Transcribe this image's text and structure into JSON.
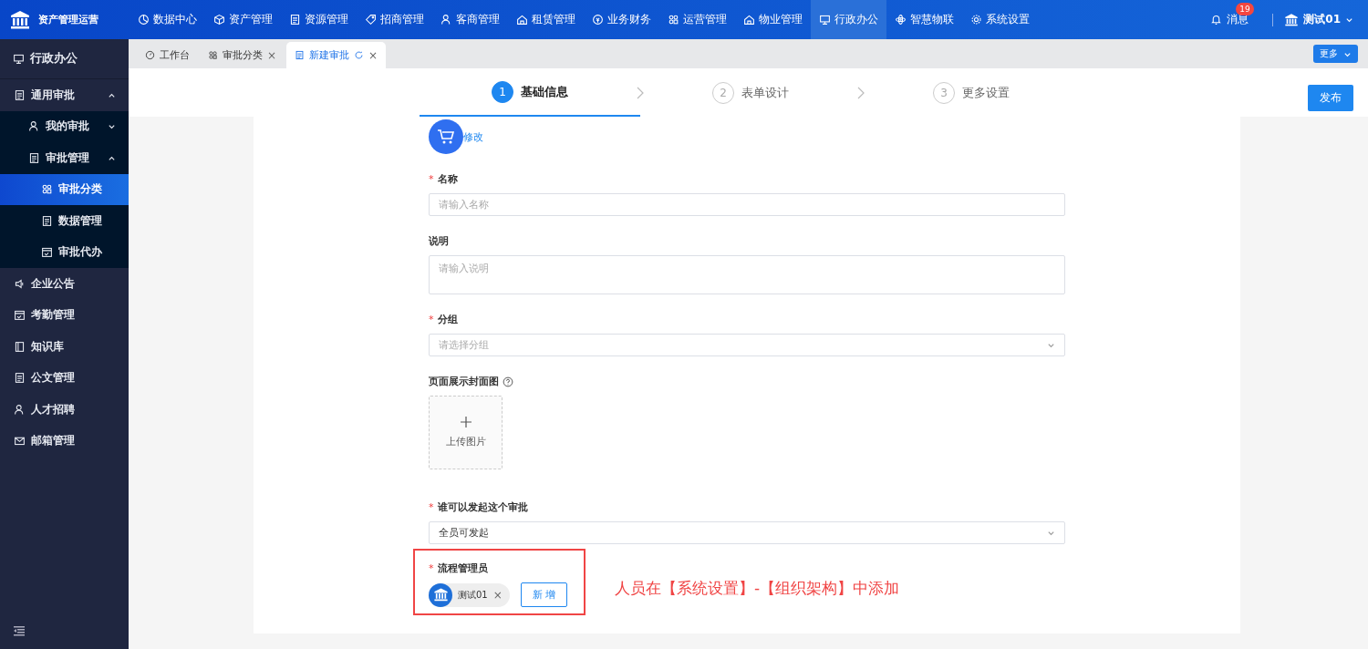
{
  "topbar": {
    "logo_title": "资产管理运营",
    "nav": [
      {
        "label": "数据中心",
        "selected": false
      },
      {
        "label": "资产管理",
        "selected": false
      },
      {
        "label": "资源管理",
        "selected": false
      },
      {
        "label": "招商管理",
        "selected": false
      },
      {
        "label": "客商管理",
        "selected": false
      },
      {
        "label": "租赁管理",
        "selected": false
      },
      {
        "label": "业务财务",
        "selected": false
      },
      {
        "label": "运营管理",
        "selected": false
      },
      {
        "label": "物业管理",
        "selected": false
      },
      {
        "label": "行政办公",
        "selected": true
      },
      {
        "label": "智慧物联",
        "selected": false
      },
      {
        "label": "系统设置",
        "selected": false
      }
    ],
    "messages": {
      "label": "消息",
      "badge": "19"
    },
    "user": {
      "name": "测试01"
    }
  },
  "sidebar": {
    "title": "行政办公",
    "items": [
      {
        "label": "通用审批",
        "selected": false,
        "expanded": true,
        "children": [
          {
            "label": "我的审批",
            "selected": false,
            "expanded": false
          },
          {
            "label": "审批管理",
            "selected": false,
            "expanded": true,
            "children": [
              {
                "label": "审批分类",
                "selected": true
              },
              {
                "label": "数据管理",
                "selected": false
              },
              {
                "label": "审批代办",
                "selected": false
              }
            ]
          }
        ]
      },
      {
        "label": "企业公告",
        "selected": false
      },
      {
        "label": "考勤管理",
        "selected": false
      },
      {
        "label": "知识库",
        "selected": false
      },
      {
        "label": "公文管理",
        "selected": false
      },
      {
        "label": "人才招聘",
        "selected": false
      },
      {
        "label": "邮箱管理",
        "selected": false
      }
    ]
  },
  "tabs": [
    {
      "label": "工作台",
      "selected": false
    },
    {
      "label": "审批分类",
      "selected": false,
      "close_mark": "×"
    },
    {
      "label": "新建审批",
      "selected": true,
      "close_mark": "×"
    }
  ],
  "more_button": "更多",
  "steps": [
    {
      "number": "1",
      "label": "基础信息",
      "selected": true
    },
    {
      "number": "2",
      "label": "表单设计",
      "selected": false
    },
    {
      "number": "3",
      "label": "更多设置",
      "selected": false
    }
  ],
  "publish_button": "发布",
  "form": {
    "icon_edit_link": "修改",
    "fields": [
      {
        "kind": "input",
        "label": "名称",
        "required_mark": "*",
        "placeholder": "请输入名称"
      },
      {
        "kind": "textarea",
        "label": "说明",
        "placeholder": "请输入说明"
      },
      {
        "kind": "select",
        "label": "分组",
        "required_mark": "*",
        "placeholder": "请选择分组"
      },
      {
        "kind": "upload",
        "label": "页面展示封面图",
        "upload_label": "上传图片"
      },
      {
        "kind": "select",
        "label": "谁可以发起这个审批",
        "required_mark": "*",
        "value": "全员可发起"
      },
      {
        "kind": "people",
        "label": "流程管理员",
        "required_mark": "*",
        "highlighted": true,
        "people": [
          {
            "name": "测试01",
            "remove_mark": "×"
          }
        ],
        "add_button": "新 增"
      }
    ]
  },
  "annotation": "人员在【系统设置】-【组织架构】中添加"
}
